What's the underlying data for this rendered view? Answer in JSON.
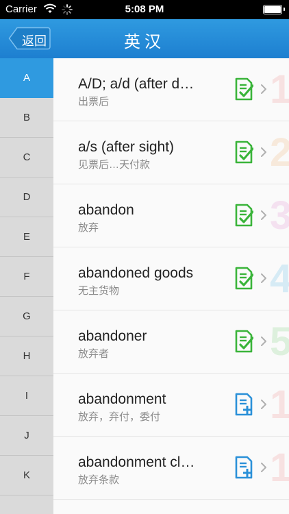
{
  "status_bar": {
    "carrier": "Carrier",
    "time": "5:08 PM"
  },
  "nav": {
    "back_label": "返回",
    "title": "英汉"
  },
  "sidebar": {
    "items": [
      "A",
      "B",
      "C",
      "D",
      "E",
      "F",
      "G",
      "H",
      "I",
      "J",
      "K"
    ],
    "active_index": 0,
    "accent_color": "#2f9ae0"
  },
  "list": {
    "items": [
      {
        "term": "A/D; a/d (after d…",
        "translation": "出票后",
        "status": "checked",
        "rank": "1",
        "rank_color": "#f08c8c"
      },
      {
        "term": "a/s (after sight)",
        "translation": "见票后…天付款",
        "status": "checked",
        "rank": "2",
        "rank_color": "#f0b070"
      },
      {
        "term": "abandon",
        "translation": "放弃",
        "status": "checked",
        "rank": "3",
        "rank_color": "#e08ad0"
      },
      {
        "term": "abandoned goods",
        "translation": "无主货物",
        "status": "checked",
        "rank": "4",
        "rank_color": "#5ab8e8"
      },
      {
        "term": "abandoner",
        "translation": "放弃者",
        "status": "checked",
        "rank": "5",
        "rank_color": "#7ad07a"
      },
      {
        "term": "abandonment",
        "translation": "放弃，弃付，委付",
        "status": "add",
        "rank": "1",
        "rank_color": "#f08c8c"
      },
      {
        "term": "abandonment cl…",
        "translation": "放弃条款",
        "status": "add",
        "rank": "1",
        "rank_color": "#f08c8c"
      }
    ],
    "checked_color": "#3ab43a",
    "add_color": "#2a90d8"
  }
}
